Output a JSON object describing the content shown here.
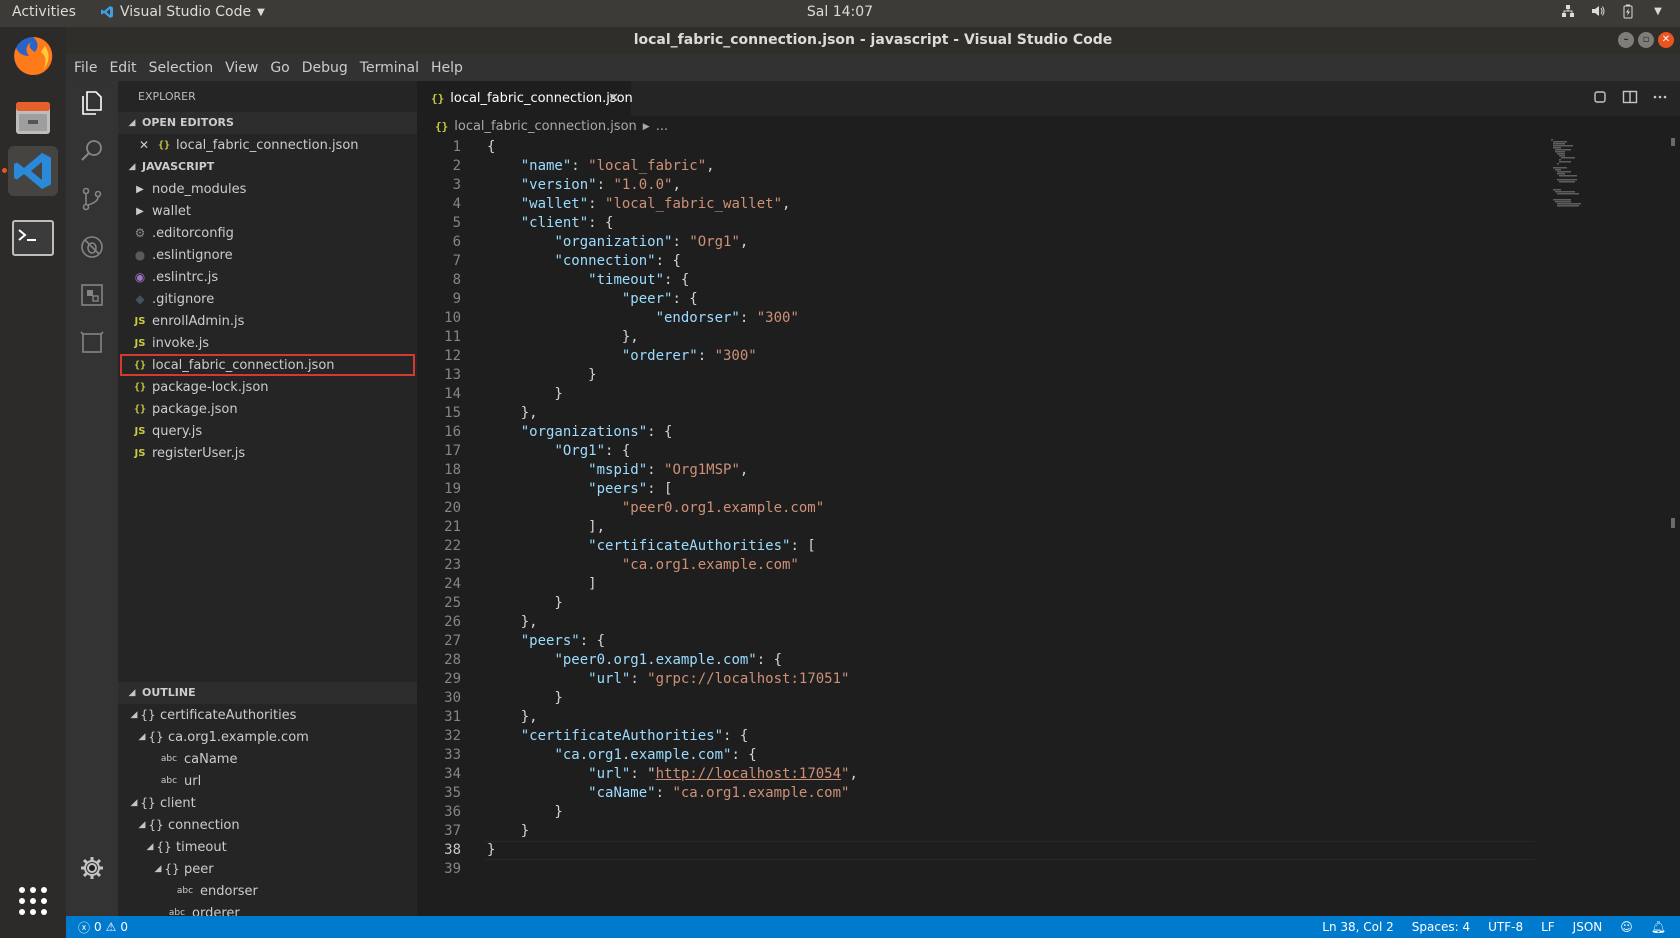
{
  "topbar": {
    "activities": "Activities",
    "app_name": "Visual Studio Code",
    "clock": "Sal 14:07"
  },
  "window": {
    "title": "local_fabric_connection.json - javascript - Visual Studio Code"
  },
  "menu": [
    "File",
    "Edit",
    "Selection",
    "View",
    "Go",
    "Debug",
    "Terminal",
    "Help"
  ],
  "sidebar": {
    "header": "EXPLORER",
    "open_editors_label": "OPEN EDITORS",
    "open_editors": [
      {
        "name": "local_fabric_connection.json"
      }
    ],
    "folder_label": "JAVASCRIPT",
    "files": [
      {
        "name": "node_modules",
        "kind": "folder"
      },
      {
        "name": "wallet",
        "kind": "folder"
      },
      {
        "name": ".editorconfig",
        "kind": "gear"
      },
      {
        "name": ".eslintignore",
        "kind": "dot"
      },
      {
        "name": ".eslintrc.js",
        "kind": "eslint"
      },
      {
        "name": ".gitignore",
        "kind": "git"
      },
      {
        "name": "enrollAdmin.js",
        "kind": "js"
      },
      {
        "name": "invoke.js",
        "kind": "js"
      },
      {
        "name": "local_fabric_connection.json",
        "kind": "json",
        "selected": true
      },
      {
        "name": "package-lock.json",
        "kind": "json"
      },
      {
        "name": "package.json",
        "kind": "json"
      },
      {
        "name": "query.js",
        "kind": "js"
      },
      {
        "name": "registerUser.js",
        "kind": "js"
      }
    ],
    "outline_label": "OUTLINE",
    "outline": [
      {
        "name": "certificateAuthorities",
        "kind": "obj",
        "depth": 0
      },
      {
        "name": "ca.org1.example.com",
        "kind": "obj",
        "depth": 1
      },
      {
        "name": "caName",
        "kind": "str",
        "depth": 2
      },
      {
        "name": "url",
        "kind": "str",
        "depth": 2
      },
      {
        "name": "client",
        "kind": "obj",
        "depth": 0
      },
      {
        "name": "connection",
        "kind": "obj",
        "depth": 1
      },
      {
        "name": "timeout",
        "kind": "obj",
        "depth": 2
      },
      {
        "name": "peer",
        "kind": "obj",
        "depth": 3
      },
      {
        "name": "endorser",
        "kind": "str",
        "depth": 4
      },
      {
        "name": "orderer",
        "kind": "str",
        "depth": 3
      }
    ]
  },
  "editor": {
    "tab_label": "local_fabric_connection.json",
    "breadcrumb_file": "local_fabric_connection.json",
    "breadcrumb_more": "...",
    "current_line": 38,
    "lines": [
      "{",
      "    \"name\": \"local_fabric\",",
      "    \"version\": \"1.0.0\",",
      "    \"wallet\": \"local_fabric_wallet\",",
      "    \"client\": {",
      "        \"organization\": \"Org1\",",
      "        \"connection\": {",
      "            \"timeout\": {",
      "                \"peer\": {",
      "                    \"endorser\": \"300\"",
      "                },",
      "                \"orderer\": \"300\"",
      "            }",
      "        }",
      "    },",
      "    \"organizations\": {",
      "        \"Org1\": {",
      "            \"mspid\": \"Org1MSP\",",
      "            \"peers\": [",
      "                \"peer0.org1.example.com\"",
      "            ],",
      "            \"certificateAuthorities\": [",
      "                \"ca.org1.example.com\"",
      "            ]",
      "        }",
      "    },",
      "    \"peers\": {",
      "        \"peer0.org1.example.com\": {",
      "            \"url\": \"grpc://localhost:17051\"",
      "        }",
      "    },",
      "    \"certificateAuthorities\": {",
      "        \"ca.org1.example.com\": {",
      "            \"url\": \"http://localhost:17054\",",
      "            \"caName\": \"ca.org1.example.com\"",
      "        }",
      "    }",
      "}",
      ""
    ]
  },
  "statusbar": {
    "errors": "0",
    "warnings": "0",
    "position": "Ln 38, Col 2",
    "spaces": "Spaces: 4",
    "encoding": "UTF-8",
    "eol": "LF",
    "language": "JSON"
  },
  "colors": {
    "accent": "#007acc",
    "selection_outline": "#d13b30",
    "ubuntu_orange": "#e95420"
  }
}
